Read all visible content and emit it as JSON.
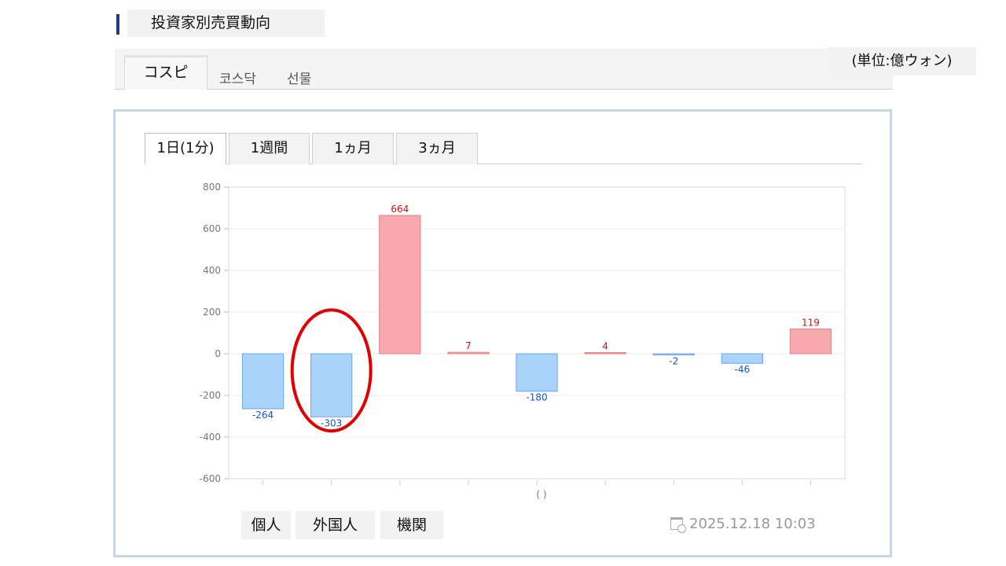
{
  "section": {
    "title": "投資家別売買動向"
  },
  "market_tabs": [
    {
      "label": "コスピ",
      "active": true
    },
    {
      "label": "코스닥",
      "active": false
    },
    {
      "label": "선물",
      "active": false
    }
  ],
  "unit_label": "(単位:億ウォン)",
  "period_tabs": [
    {
      "label": "1日(1分)",
      "active": true
    },
    {
      "label": "1週間",
      "active": false
    },
    {
      "label": "1ヵ月",
      "active": false
    },
    {
      "label": "3ヵ月",
      "active": false
    }
  ],
  "legend": [
    "個人",
    "外国人",
    "機関"
  ],
  "timestamp": "2025.12.18 10:03",
  "colors": {
    "positive": "#f9a9ad",
    "positive_border": "#e57f85",
    "negative": "#a9d3fb",
    "negative_border": "#6fa6e4",
    "positive_text": "#cc1111",
    "negative_text": "#1155cc",
    "highlight": "#e00000"
  },
  "chart_data": {
    "type": "bar",
    "values": [
      -264,
      -303,
      664,
      7,
      -180,
      4,
      -2,
      -46,
      119
    ],
    "value_labels": [
      "-264",
      "-303",
      "664",
      "7",
      "-180",
      "4",
      "-2",
      "-46",
      "119"
    ],
    "ylim": [
      -600,
      800
    ],
    "y_ticks": [
      800,
      600,
      400,
      200,
      0,
      -200,
      -400,
      -600
    ],
    "y_tick_labels": [
      "800",
      "600",
      "400",
      "200",
      "0",
      "-200",
      "-400",
      "-600"
    ],
    "xlabel": "( )",
    "grid": true,
    "highlighted_index": 1
  }
}
